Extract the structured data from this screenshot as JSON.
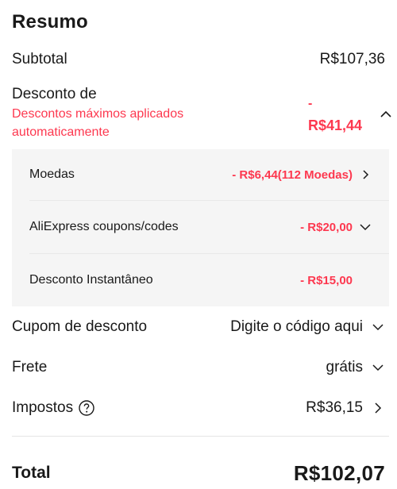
{
  "summary": {
    "title": "Resumo",
    "subtotal": {
      "label": "Subtotal",
      "value": "R$107,36"
    },
    "discount": {
      "label": "Desconto de",
      "note": "Descontos máximos aplicados automaticamente",
      "value_sign": "-",
      "value": "R$41,44",
      "expanded": true,
      "items": [
        {
          "label": "Moedas",
          "value": "- R$6,44(112 Moedas)",
          "icon": "chevron-right-icon"
        },
        {
          "label": "AliExpress coupons/codes",
          "value": "- R$20,00",
          "icon": "chevron-down-icon"
        },
        {
          "label": "Desconto Instantâneo",
          "value": "- R$15,00",
          "icon": ""
        }
      ]
    },
    "coupon": {
      "label": "Cupom de desconto",
      "value": "Digite o código aqui"
    },
    "shipping": {
      "label": "Frete",
      "value": "grátis"
    },
    "taxes": {
      "label": "Impostos",
      "value": "R$36,15"
    },
    "total": {
      "label": "Total",
      "value": "R$102,07"
    }
  },
  "colors": {
    "accent_red": "#fd384f",
    "text": "#191919",
    "panel_bg": "#f5f5f5"
  }
}
